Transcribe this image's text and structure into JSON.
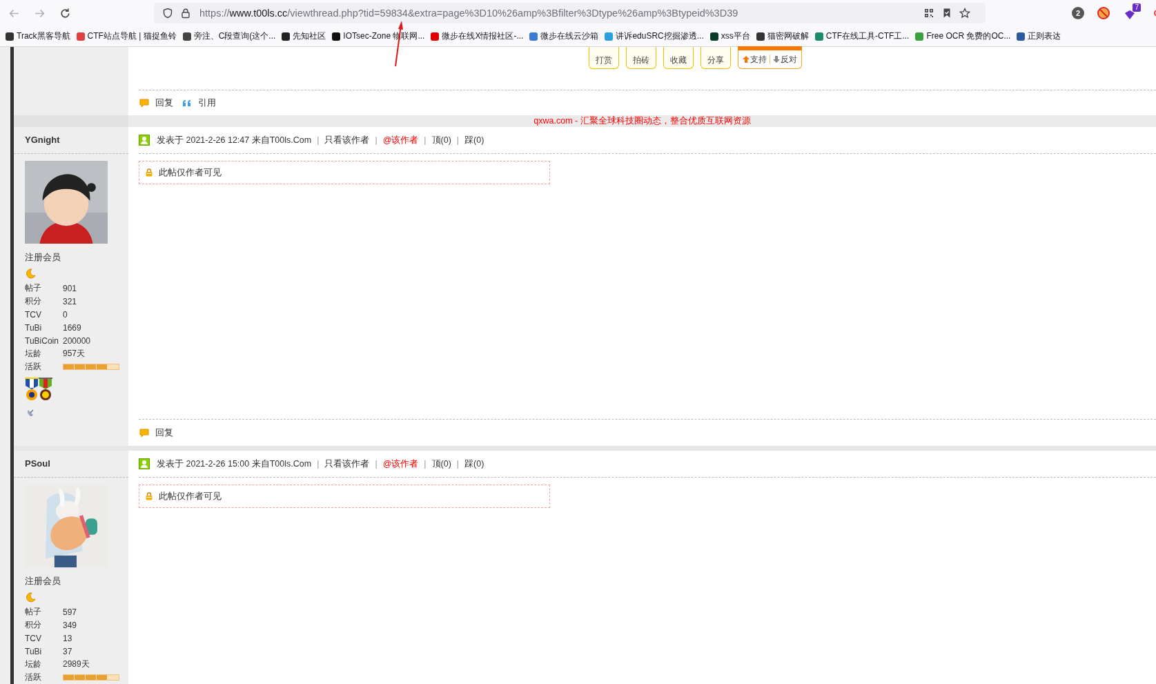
{
  "browser": {
    "url": {
      "scheme": "https://",
      "host": "www.t00ls.cc",
      "path": "/viewthread.php?tid=59834&extra=page%3D10%26amp%3Bfilter%3Dtype%26amp%3Btypeid%3D39"
    },
    "tab_count": "2",
    "extension_badge": "7",
    "bookmarks": [
      {
        "label": "Track黑客导航",
        "color": "#333333"
      },
      {
        "label": "CTF站点导航 | 猫捉鱼铃",
        "color": "#e04040"
      },
      {
        "label": "旁注、C段查询(这个...",
        "color": "#444444"
      },
      {
        "label": "先知社区",
        "color": "#222222"
      },
      {
        "label": "IOTsec-Zone 物联网...",
        "color": "#111111"
      },
      {
        "label": "微步在线X情报社区-...",
        "color": "#e00000"
      },
      {
        "label": "微步在线云沙箱",
        "color": "#3a7bd5"
      },
      {
        "label": "讲诉eduSRC挖掘渗透...",
        "color": "#2aa0e0"
      },
      {
        "label": "xss平台",
        "color": "#0a3a2a"
      },
      {
        "label": "猫密网破解",
        "color": "#333333"
      },
      {
        "label": "CTF在线工具-CTF工...",
        "color": "#1a8a6a"
      },
      {
        "label": "Free OCR 免费的OC...",
        "color": "#3aa040"
      },
      {
        "label": "正则表达",
        "color": "#2a5aa0"
      }
    ]
  },
  "previous_post": {
    "actions": [
      {
        "label": "打赏"
      },
      {
        "label": "拍砖"
      },
      {
        "label": "收藏"
      },
      {
        "label": "分享"
      }
    ],
    "support": "支持",
    "oppose": "反对",
    "footer": [
      {
        "kind": "reply",
        "label": "回复"
      },
      {
        "kind": "quote",
        "label": "引用"
      }
    ]
  },
  "ad_text": "qxwa.com - 汇聚全球科技圈动态，整合优质互联网资源",
  "posts": [
    {
      "author": "YGnight",
      "rank": "注册会员",
      "stats": [
        {
          "label": "帖子",
          "value": "901"
        },
        {
          "label": "积分",
          "value": "321"
        },
        {
          "label": "TCV",
          "value": "0"
        },
        {
          "label": "TuBi",
          "value": "1669"
        },
        {
          "label": "TuBiCoin",
          "value": "200000"
        },
        {
          "label": "坛龄",
          "value": "957天"
        }
      ],
      "activity_label": "活跃",
      "level": 0.8,
      "medals": [
        {
          "kind": "sun"
        },
        {
          "kind": "clock"
        }
      ],
      "badges": [
        {
          "kind": "dish"
        }
      ],
      "meta": "发表于 2021-2-26 12:47 来自T00ls.Com",
      "links": [
        {
          "kind": "plain",
          "sep": "|",
          "label": "只看该作者"
        },
        {
          "kind": "mention",
          "sep": "|",
          "label": "@该作者"
        },
        {
          "kind": "plain",
          "sep": "|",
          "label": "顶(0)"
        },
        {
          "kind": "plain",
          "sep": "|",
          "label": "踩(0)"
        }
      ],
      "notice": "此帖仅作者可见",
      "footer": [
        {
          "kind": "reply",
          "label": "回复"
        }
      ]
    },
    {
      "author": "PSoul",
      "rank": "注册会员",
      "stats": [
        {
          "label": "帖子",
          "value": "597"
        },
        {
          "label": "积分",
          "value": "349"
        },
        {
          "label": "TCV",
          "value": "13"
        },
        {
          "label": "TuBi",
          "value": "37"
        },
        {
          "label": "坛龄",
          "value": "2989天"
        }
      ],
      "activity_label": "活跃",
      "level": 0.8,
      "meta": "发表于 2021-2-26 15:00 来自T00ls.Com",
      "links": [
        {
          "kind": "plain",
          "sep": "|",
          "label": "只看该作者"
        },
        {
          "kind": "mention",
          "sep": "|",
          "label": "@该作者"
        },
        {
          "kind": "plain",
          "sep": "|",
          "label": "顶(0)"
        },
        {
          "kind": "plain",
          "sep": "|",
          "label": "踩(0)"
        }
      ],
      "notice": "此帖仅作者可见"
    }
  ]
}
